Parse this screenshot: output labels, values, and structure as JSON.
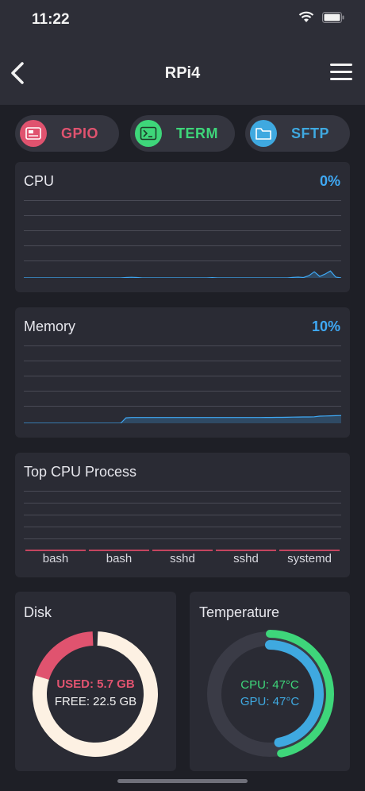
{
  "status_bar": {
    "time": "11:22"
  },
  "nav": {
    "title": "RPi4"
  },
  "actions": [
    {
      "label": "GPIO",
      "color": "#e0536f",
      "icon": "gpio-chip-icon"
    },
    {
      "label": "TERM",
      "color": "#3ed67a",
      "icon": "terminal-icon"
    },
    {
      "label": "SFTP",
      "color": "#3fa9e0",
      "icon": "folder-icon"
    }
  ],
  "cpu": {
    "title": "CPU",
    "value": "0%",
    "chart_data": {
      "type": "area",
      "series": [
        {
          "values": [
            0,
            0,
            0,
            0,
            0,
            0,
            0,
            0,
            0,
            0,
            0,
            0,
            0,
            0,
            0,
            0,
            0,
            0,
            0,
            0.5,
            0.8,
            0.5,
            0,
            0,
            0,
            0,
            0,
            0,
            0,
            0,
            0,
            0,
            0,
            0,
            0,
            0.4,
            0,
            0,
            0,
            0,
            0,
            0,
            0,
            0,
            0,
            0,
            0,
            0,
            0,
            0,
            0.6,
            1,
            0.5,
            3,
            8,
            2,
            5,
            9,
            1,
            0
          ]
        }
      ],
      "ylim": [
        0,
        100
      ],
      "color": "#3fa9f5"
    }
  },
  "memory": {
    "title": "Memory",
    "value": "10%",
    "chart_data": {
      "type": "area",
      "series": [
        {
          "values": [
            0,
            0,
            0,
            0,
            0,
            0,
            0,
            0,
            0,
            0,
            0,
            0,
            0,
            0,
            0,
            0,
            0,
            0,
            0,
            7,
            7.5,
            7.5,
            7.5,
            7.5,
            7.5,
            7.5,
            7.5,
            7.5,
            7.5,
            7.5,
            7.5,
            7.5,
            7.5,
            7.5,
            7.5,
            7.5,
            7.5,
            7.5,
            7.5,
            7.5,
            7.5,
            7.5,
            7.5,
            7.5,
            7.5,
            7.6,
            7.6,
            7.7,
            7.7,
            7.8,
            8,
            8.1,
            8.2,
            8.2,
            8.4,
            9.2,
            9.4,
            9.6,
            9.8,
            10
          ]
        }
      ],
      "ylim": [
        0,
        100
      ],
      "color": "#3fa9f5"
    }
  },
  "top_cpu": {
    "title": "Top CPU Process",
    "chart_data": {
      "type": "bar",
      "categories": [
        "bash",
        "bash",
        "sshd",
        "sshd",
        "systemd"
      ],
      "values": [
        0,
        0,
        0,
        0,
        0
      ],
      "color": "#c4455f"
    }
  },
  "disk": {
    "title": "Disk",
    "used": "USED: 5.7 GB",
    "free": "FREE: 22.5 GB",
    "chart_data": {
      "type": "pie",
      "categories": [
        "USED",
        "FREE"
      ],
      "values": [
        5.7,
        22.5
      ],
      "colors": [
        "#e0536f",
        "#fdf1e3"
      ]
    }
  },
  "temperature": {
    "title": "Temperature",
    "cpu": "CPU: 47°C",
    "gpu": "GPU: 47°C",
    "chart_data": {
      "type": "pie",
      "series": [
        {
          "name": "CPU",
          "value": 47,
          "max": 100,
          "color": "#3ed67a"
        },
        {
          "name": "GPU",
          "value": 47,
          "max": 100,
          "color": "#3fa9e0"
        }
      ]
    }
  }
}
